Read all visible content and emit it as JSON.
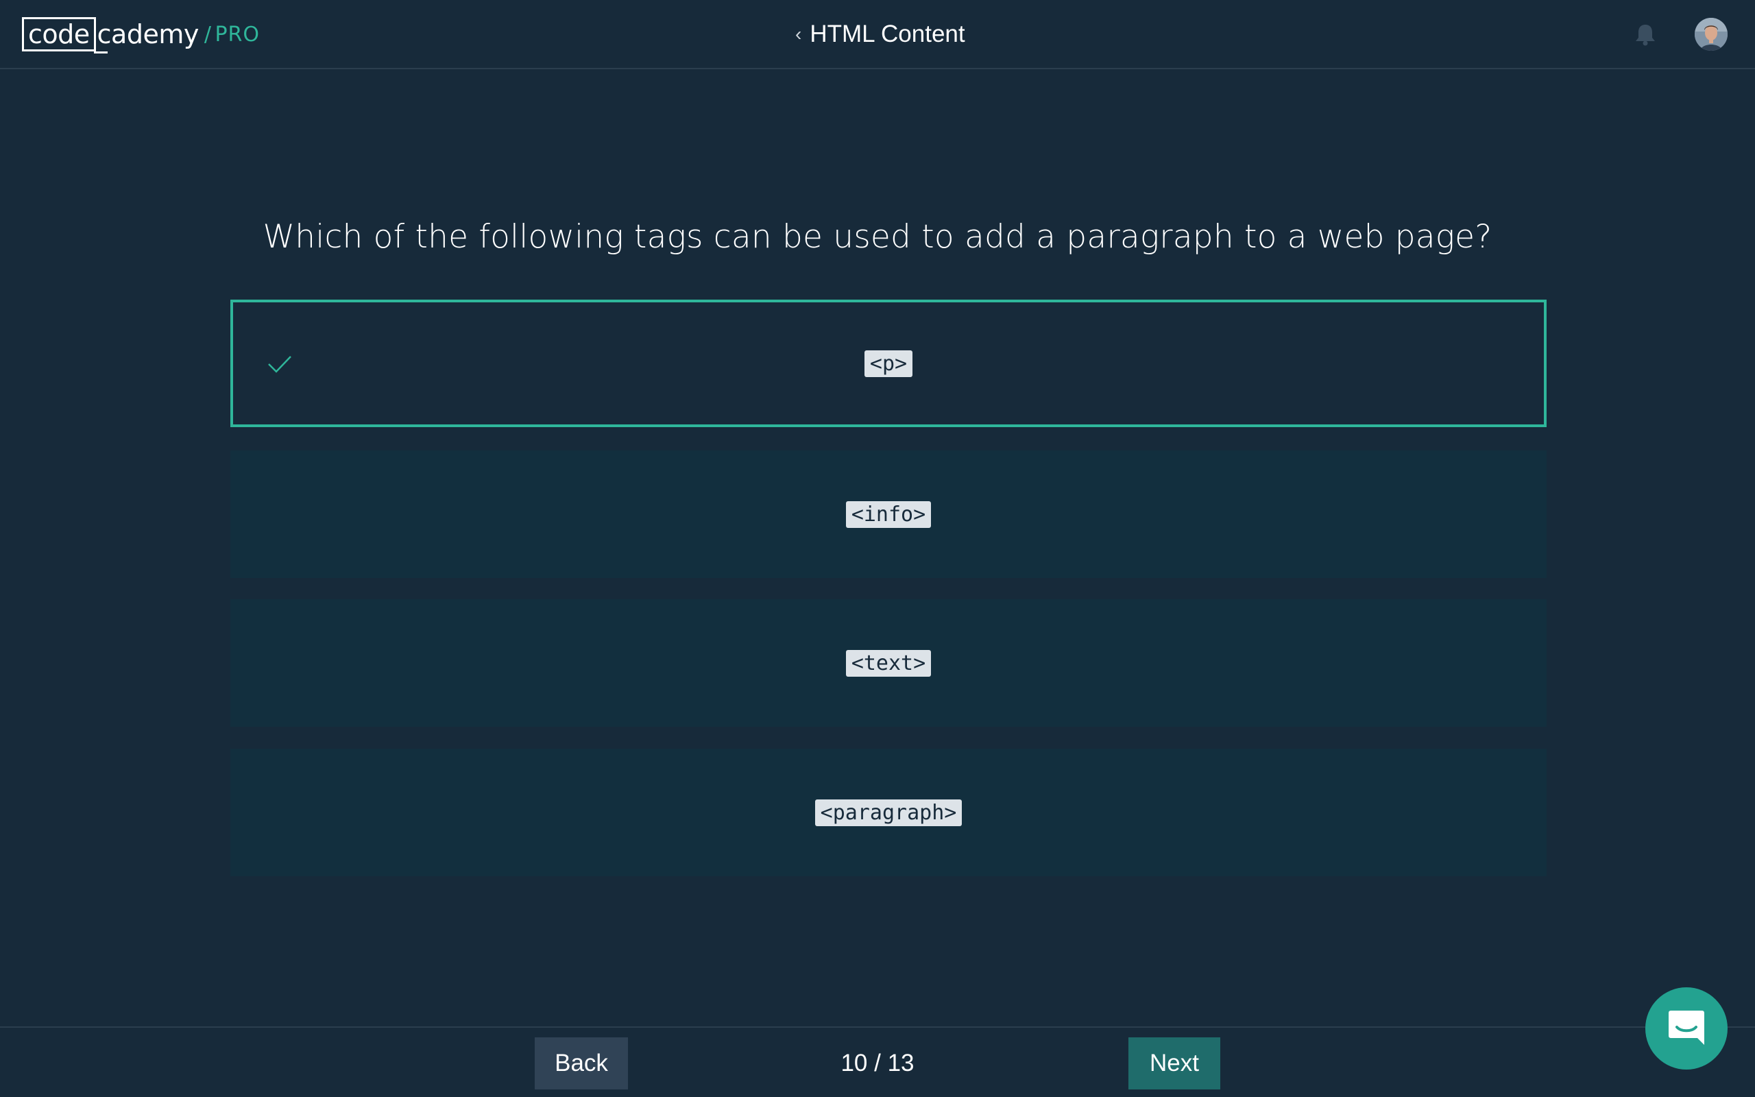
{
  "header": {
    "logo": {
      "code": "code",
      "rest": "cademy",
      "slash": "/",
      "tier": "PRO"
    },
    "nav_title": "HTML Content",
    "icons": {
      "back": "chevron-left-icon",
      "notifications": "bell-icon",
      "profile": "avatar"
    }
  },
  "quiz": {
    "question": "Which of the following tags can be used to add a paragraph to a web page?",
    "options": [
      {
        "label": "<p>",
        "selected": true
      },
      {
        "label": "<info>",
        "selected": false
      },
      {
        "label": "<text>",
        "selected": false
      },
      {
        "label": "<paragraph>",
        "selected": false
      }
    ]
  },
  "footer": {
    "back_label": "Back",
    "progress": "10 / 13",
    "next_label": "Next"
  },
  "colors": {
    "background": "#172a3a",
    "accent": "#2fb69a",
    "option_bg": "#122f3e",
    "next_button": "#1f6c6b",
    "back_button": "#304356",
    "chat_button": "#23a290"
  }
}
